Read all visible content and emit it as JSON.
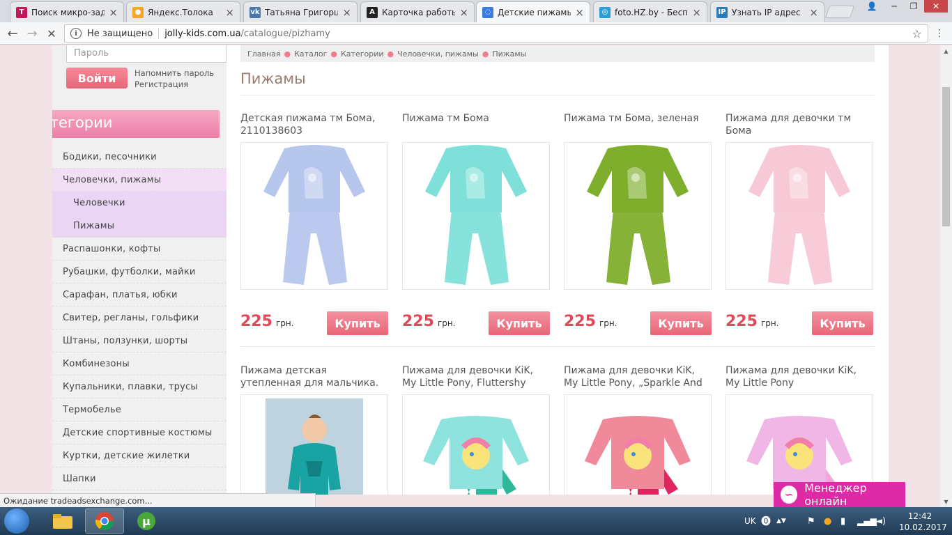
{
  "browser": {
    "tabs": [
      {
        "title": "Поиск микро-задач",
        "fav_text": "T",
        "fav_color": "#c2185b"
      },
      {
        "title": "Яндекс.Толока",
        "fav_text": "●",
        "fav_color": "#f5a623"
      },
      {
        "title": "Татьяна Григорцевич",
        "fav_text": "vk",
        "fav_color": "#4a76a8"
      },
      {
        "title": "Карточка работы #",
        "fav_text": "A",
        "fav_color": "#222222"
      },
      {
        "title": "Детские пижамы —",
        "fav_text": "◌",
        "fav_color": "#3b7ddd"
      },
      {
        "title": "foto.HZ.by - Беспла",
        "fav_text": "◎",
        "fav_color": "#2a9fd6"
      },
      {
        "title": "Узнать IP адрес",
        "fav_text": "IP",
        "fav_color": "#2b7bb9"
      }
    ],
    "security_label": "Не защищено",
    "url_host": "jolly-kids.com.ua",
    "url_path": "/catalogue/pizhamy"
  },
  "sidebar": {
    "password_placeholder": "Пароль",
    "login_label": "Войти",
    "forgot_label": "Напомнить пароль",
    "register_label": "Регистрация",
    "categories_title": "Категории",
    "items": [
      {
        "label": "Бодики, песочники",
        "state": ""
      },
      {
        "label": "Человечки, пижамы",
        "state": "active"
      },
      {
        "label": "Человечки",
        "state": "sub"
      },
      {
        "label": "Пижамы",
        "state": "sub"
      },
      {
        "label": "Распашонки, кофты",
        "state": ""
      },
      {
        "label": "Рубашки, футболки, майки",
        "state": ""
      },
      {
        "label": "Сарафан, платья, юбки",
        "state": ""
      },
      {
        "label": "Свитер, регланы, гольфики",
        "state": ""
      },
      {
        "label": "Штаны, ползунки, шорты",
        "state": ""
      },
      {
        "label": "Комбинезоны",
        "state": ""
      },
      {
        "label": "Купальники, плавки, трусы",
        "state": ""
      },
      {
        "label": "Термобелье",
        "state": ""
      },
      {
        "label": "Детские спортивные костюмы",
        "state": ""
      },
      {
        "label": "Куртки, детские жилетки",
        "state": ""
      },
      {
        "label": "Шапки",
        "state": ""
      }
    ]
  },
  "breadcrumb": [
    "Главная",
    "Каталог",
    "Категории",
    "Человечки, пижамы",
    "Пижамы"
  ],
  "page_title": "Пижамы",
  "currency": "грн.",
  "buy_label": "Купить",
  "products": [
    {
      "name": "Детская пижама тм Бома, 2110138603",
      "price": "225",
      "top": "#b6c6ec",
      "bottom": "#b6c6ec",
      "kind": "pajama"
    },
    {
      "name": "Пижама тм Бома",
      "price": "225",
      "top": "#7fe0d9",
      "bottom": "#7fe0d9",
      "kind": "pajama"
    },
    {
      "name": "Пижама тм Бома, зеленая",
      "price": "225",
      "top": "#7fae2c",
      "bottom": "#7fae2c",
      "kind": "pajama"
    },
    {
      "name": "Пижама для девочки тм Бома",
      "price": "225",
      "top": "#f7c9d6",
      "bottom": "#f7c9d6",
      "kind": "pajama"
    },
    {
      "name": "Пижама детская утепленная для мальчика. тм Модный",
      "price": "",
      "top": "#1aa3a3",
      "bottom": "#1aa3a3",
      "kind": "boy"
    },
    {
      "name": "Пижама для девочки KiK, My Little Pony, Fluttershy",
      "price": "",
      "top": "#8fe3de",
      "bottom": "#2fb79a",
      "kind": "pony"
    },
    {
      "name": "Пижама для девочки KiK, My Little Pony, „Sparkle And",
      "price": "",
      "top": "#f08a9a",
      "bottom": "#e0245e",
      "kind": "pony"
    },
    {
      "name": "Пижама для девочки KiK, My Little Pony",
      "price": "",
      "top": "#f0b6e6",
      "bottom": "#f3a6d8",
      "kind": "pony"
    }
  ],
  "status_text": "Ожидание tradeadsexchange.com...",
  "chat_label": "Менеджер онлайн",
  "taskbar": {
    "lang": "UK",
    "time": "12:42",
    "date": "10.02.2017"
  }
}
